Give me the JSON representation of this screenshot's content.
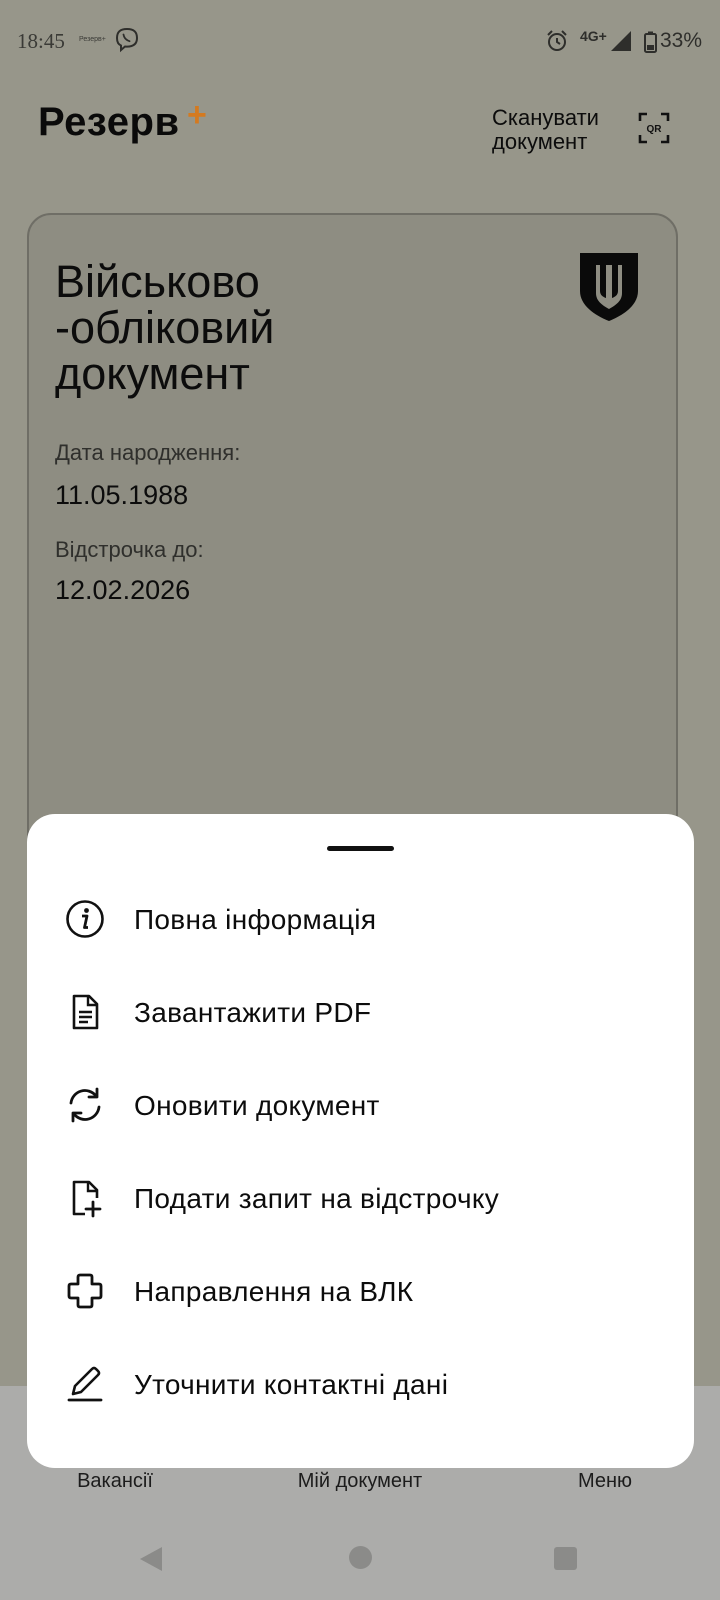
{
  "status_bar": {
    "time": "18:45",
    "mini_app_label": "Резерв+",
    "network": "4G+",
    "battery": "33%"
  },
  "header": {
    "brand": "Резерв",
    "brand_accent": "+",
    "scan_line1": "Сканувати",
    "scan_line2": "документ",
    "qr_label": "QR"
  },
  "card": {
    "title_line1": "Військово",
    "title_line2": "-обліковий",
    "title_line3": "документ",
    "birth_label": "Дата народження:",
    "birth_value": "11.05.1988",
    "deferral_label": "Відстрочка до:",
    "deferral_value": "12.02.2026"
  },
  "sheet": {
    "items": [
      {
        "label": "Повна інформація",
        "icon": "info-icon"
      },
      {
        "label": "Завантажити PDF",
        "icon": "document-icon"
      },
      {
        "label": "Оновити документ",
        "icon": "refresh-icon"
      },
      {
        "label": "Подати запит на відстрочку",
        "icon": "file-plus-icon"
      },
      {
        "label": "Направлення на ВЛК",
        "icon": "medical-cross-icon"
      },
      {
        "label": "Уточнити контактні дані",
        "icon": "pencil-icon"
      }
    ]
  },
  "bottom_nav": {
    "vacancies": "Вакансії",
    "my_document": "Мій документ",
    "menu": "Меню"
  },
  "colors": {
    "overlay_background": "#97968a",
    "brand_accent": "#d47a20",
    "sheet_background": "#ffffff"
  }
}
